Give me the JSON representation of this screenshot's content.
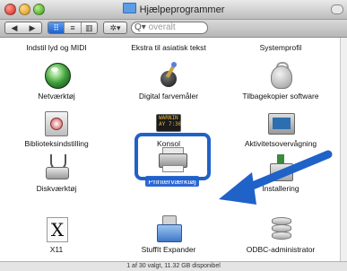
{
  "window": {
    "title": "Hjælpeprogrammer",
    "status": "1 af 30 valgt, 11.32 GB disponibel"
  },
  "toolbar": {
    "nav_back": "◀",
    "nav_forward": "▶",
    "view_icons": "⠿",
    "view_list": "≡",
    "view_columns": "▥",
    "action": "✲▾",
    "search_glyph": "Q▾",
    "search_value": "overalt"
  },
  "top_row_labels": [
    "Indstil lyd og MIDI",
    "Ekstra til asiatisk tekst",
    "Systemprofil"
  ],
  "items": [
    {
      "label": "Netværktøj",
      "icon": "network-utility-icon"
    },
    {
      "label": "Digital farvemåler",
      "icon": "digital-color-meter-icon"
    },
    {
      "label": "Tilbagekopier software",
      "icon": "backup-software-icon"
    },
    {
      "label": "Biblioteksindstilling",
      "icon": "directory-utility-icon"
    },
    {
      "label": "Konsol",
      "icon": "console-icon",
      "screen_text": "WARNIN\nAY 7:36"
    },
    {
      "label": "Aktivitetsovervågning",
      "icon": "activity-monitor-icon"
    },
    {
      "label": "Diskværktøj",
      "icon": "disk-utility-icon"
    },
    {
      "label": "Printerværktøj",
      "icon": "printer-utility-icon",
      "selected": true
    },
    {
      "label": "Installering",
      "icon": "installer-icon"
    },
    {
      "label": "X11",
      "icon": "x11-icon",
      "glyph": "X"
    },
    {
      "label": "StuffIt Expander",
      "icon": "stuffit-expander-icon"
    },
    {
      "label": "ODBC-administrator",
      "icon": "odbc-administrator-icon"
    }
  ],
  "colors": {
    "selection": "#2f69d6",
    "highlight_frame": "#1f62c8",
    "arrow": "#1f62c8"
  }
}
